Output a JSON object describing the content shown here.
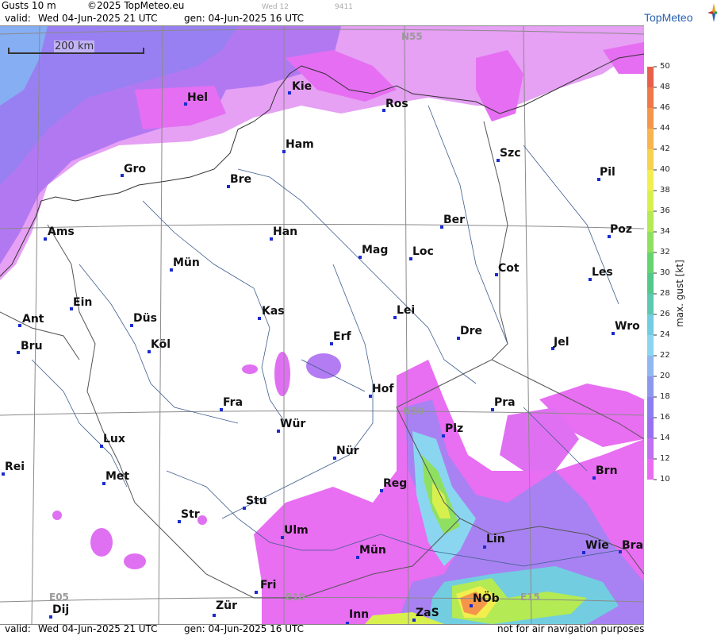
{
  "header": {
    "title": "Gusts 10 m",
    "copyright": "©2025 TopMeteo.eu",
    "run_code": "Wed 12",
    "run_id": "9411",
    "valid_label": "valid:",
    "valid_time": "Wed  04-Jun-2025  21 UTC",
    "gen_label": "gen: 04-Jun-2025 16 UTC"
  },
  "logo": {
    "name": "TopMeteo"
  },
  "footer": {
    "valid_label": "valid:",
    "valid_time": "Wed  04-Jun-2025  21 UTC",
    "gen_label": "gen: 04-Jun-2025 16 UTC",
    "disclaimer": "not for air navigation purposes"
  },
  "map": {
    "scale_label": "200 km",
    "grid_labels": [
      "N55",
      "N50",
      "E05",
      "E10",
      "E15"
    ],
    "cities": [
      "Hel",
      "Kie",
      "Ros",
      "Ham",
      "Szc",
      "Gro",
      "Bre",
      "Pil",
      "Ams",
      "Han",
      "Ber",
      "Poz",
      "Mag",
      "Loc",
      "Mün",
      "Cot",
      "Les",
      "Ein",
      "Kas",
      "Lei",
      "Ant",
      "Düs",
      "Dre",
      "Wro",
      "Erf",
      "Köl",
      "Jel",
      "Bru",
      "Hof",
      "Fra",
      "Pra",
      "Wür",
      "Plz",
      "Lux",
      "Nür",
      "Rei",
      "Met",
      "Reg",
      "Brn",
      "Stu",
      "Str",
      "Ulm",
      "Lin",
      "Mün",
      "Wie",
      "Bra",
      "Fri",
      "Zür",
      "NÖb",
      "Dij",
      "Inn",
      "ZaS"
    ]
  },
  "legend": {
    "title": "max. gust [kt]",
    "unit": "kt",
    "ticks": [
      "50",
      "48",
      "46",
      "44",
      "42",
      "40",
      "38",
      "36",
      "34",
      "32",
      "30",
      "28",
      "26",
      "24",
      "22",
      "20",
      "18",
      "16",
      "14",
      "12",
      "10"
    ],
    "colors": [
      "#e8604a",
      "#f07848",
      "#f5954a",
      "#f8b44e",
      "#f6d24e",
      "#f2ee4e",
      "#d8f04e",
      "#b4ea54",
      "#8fe060",
      "#66d46e",
      "#52c88a",
      "#5cc8b0",
      "#72cde0",
      "#8ad6f0",
      "#92b6f0",
      "#8c98ee",
      "#8a7ef0",
      "#9a70f2",
      "#c070f2",
      "#ea6cf2"
    ]
  }
}
